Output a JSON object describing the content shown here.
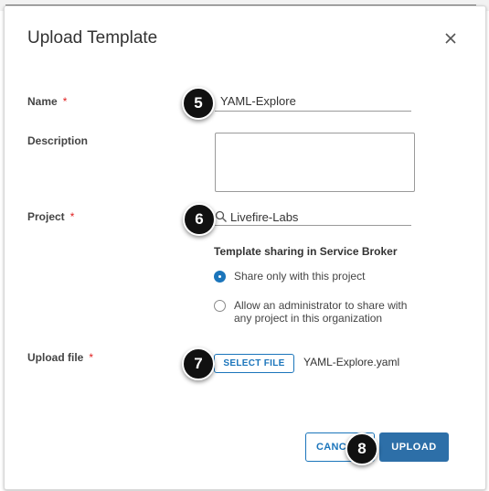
{
  "dialog": {
    "title": "Upload Template",
    "close_icon": "close-icon"
  },
  "form": {
    "name": {
      "label": "Name",
      "required_mark": "*",
      "value": "YAML-Explore"
    },
    "description": {
      "label": "Description",
      "value": ""
    },
    "project": {
      "label": "Project",
      "required_mark": "*",
      "value": "Livefire-Labs",
      "icon": "search-icon"
    },
    "sharing": {
      "heading": "Template sharing in Service Broker",
      "options": [
        {
          "label": "Share only with this project",
          "selected": true
        },
        {
          "label_line1": "Allow an administrator to share with",
          "label_line2": "any project in this organization",
          "selected": false
        }
      ]
    },
    "upload": {
      "label": "Upload file",
      "required_mark": "*",
      "button": "SELECT FILE",
      "filename": "YAML-Explore.yaml"
    }
  },
  "footer": {
    "cancel": "CANC",
    "upload": "UPLOAD"
  },
  "callouts": [
    "5",
    "6",
    "7",
    "8"
  ],
  "colors": {
    "accent": "#1b75bb",
    "primary_button": "#2d6fa8",
    "required": "#e02020",
    "callout": "#111111"
  }
}
